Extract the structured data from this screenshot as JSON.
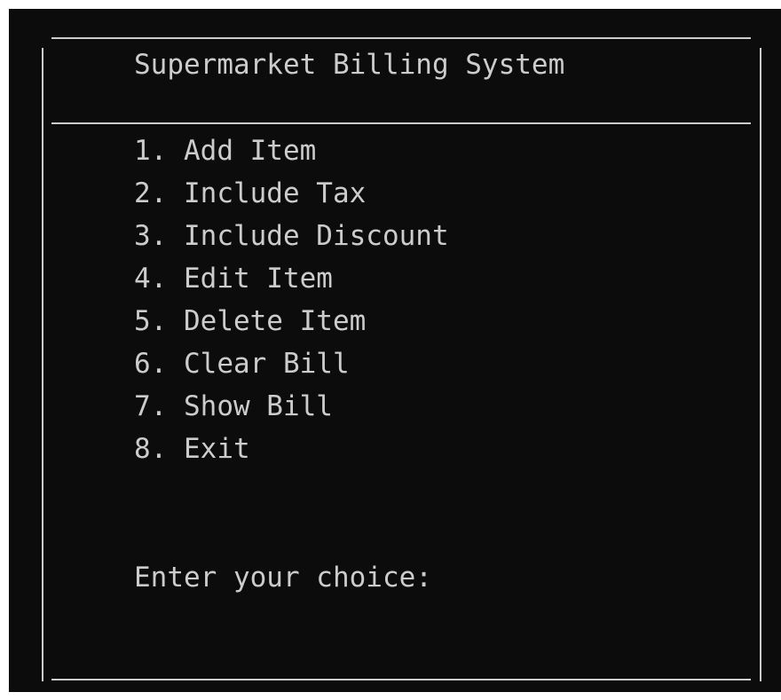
{
  "window": {
    "background": "#0c0c0c",
    "foreground": "#cccccc"
  },
  "header": {
    "title": "Supermarket Billing System"
  },
  "menu": {
    "items": [
      {
        "label": "1. Add Item"
      },
      {
        "label": "2. Include Tax"
      },
      {
        "label": "3. Include Discount"
      },
      {
        "label": "4. Edit Item"
      },
      {
        "label": "5. Delete Item"
      },
      {
        "label": "6. Clear Bill"
      },
      {
        "label": "7. Show Bill"
      },
      {
        "label": "8. Exit"
      }
    ]
  },
  "prompt": {
    "text": "Enter your choice:"
  }
}
